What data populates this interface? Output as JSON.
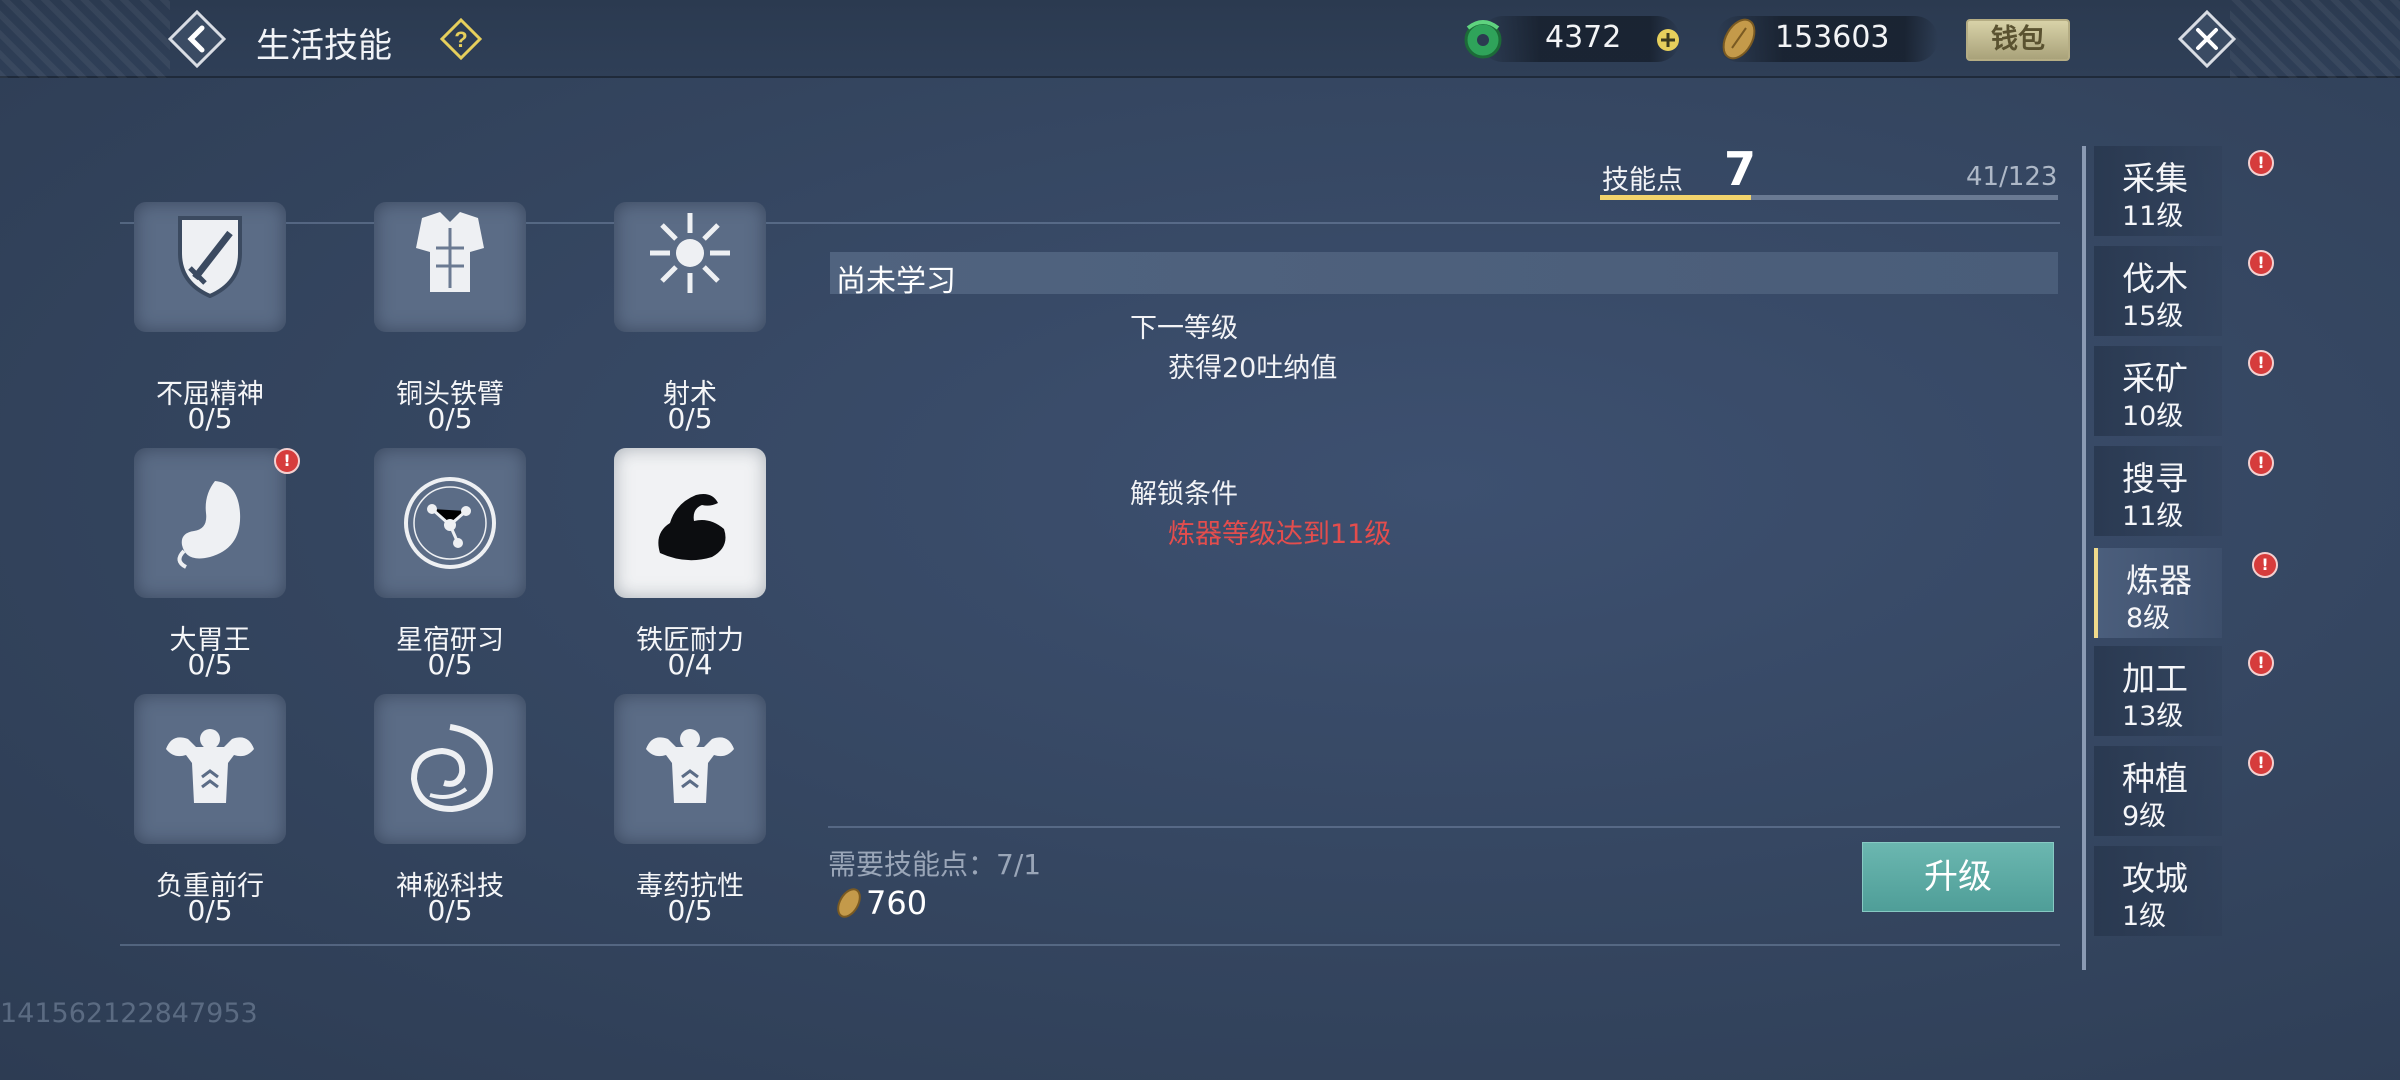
{
  "header": {
    "title": "生活技能",
    "currency_jade": "4372",
    "currency_coin": "153603",
    "wallet_label": "钱包"
  },
  "skill_points": {
    "label": "技能点",
    "value": "7",
    "count": "41/123",
    "progress_fraction": 0.33
  },
  "skills": [
    {
      "name": "不屈精神",
      "level": "0/5"
    },
    {
      "name": "铜头铁臂",
      "level": "0/5"
    },
    {
      "name": "射术",
      "level": "0/5"
    },
    {
      "name": "大胃王",
      "level": "0/5"
    },
    {
      "name": "星宿研习",
      "level": "0/5"
    },
    {
      "name": "铁匠耐力",
      "level": "0/4"
    },
    {
      "name": "负重前行",
      "level": "0/5"
    },
    {
      "name": "神秘科技",
      "level": "0/5"
    },
    {
      "name": "毒药抗性",
      "level": "0/5"
    }
  ],
  "detail": {
    "status": "尚未学习",
    "next_level_title": "下一等级",
    "next_level_text": "获得20吐纳值",
    "unlock_title": "解锁条件",
    "unlock_text": "炼器等级达到11级",
    "requirement": "需要技能点：7/1",
    "cost": "760",
    "upgrade_label": "升级"
  },
  "tabs": [
    {
      "name": "采集",
      "level": "11级"
    },
    {
      "name": "伐木",
      "level": "15级"
    },
    {
      "name": "采矿",
      "level": "10级"
    },
    {
      "name": "搜寻",
      "level": "11级"
    },
    {
      "name": "炼器",
      "level": "8级"
    },
    {
      "name": "加工",
      "level": "13级"
    },
    {
      "name": "种植",
      "level": "9级"
    },
    {
      "name": "攻城",
      "level": "1级"
    }
  ],
  "footer": {
    "user_id": "141562122847953"
  },
  "colors": {
    "accent_gold": "#f2d36c",
    "alert_red": "#e34d4d",
    "button_teal": "#5aa9a3"
  }
}
